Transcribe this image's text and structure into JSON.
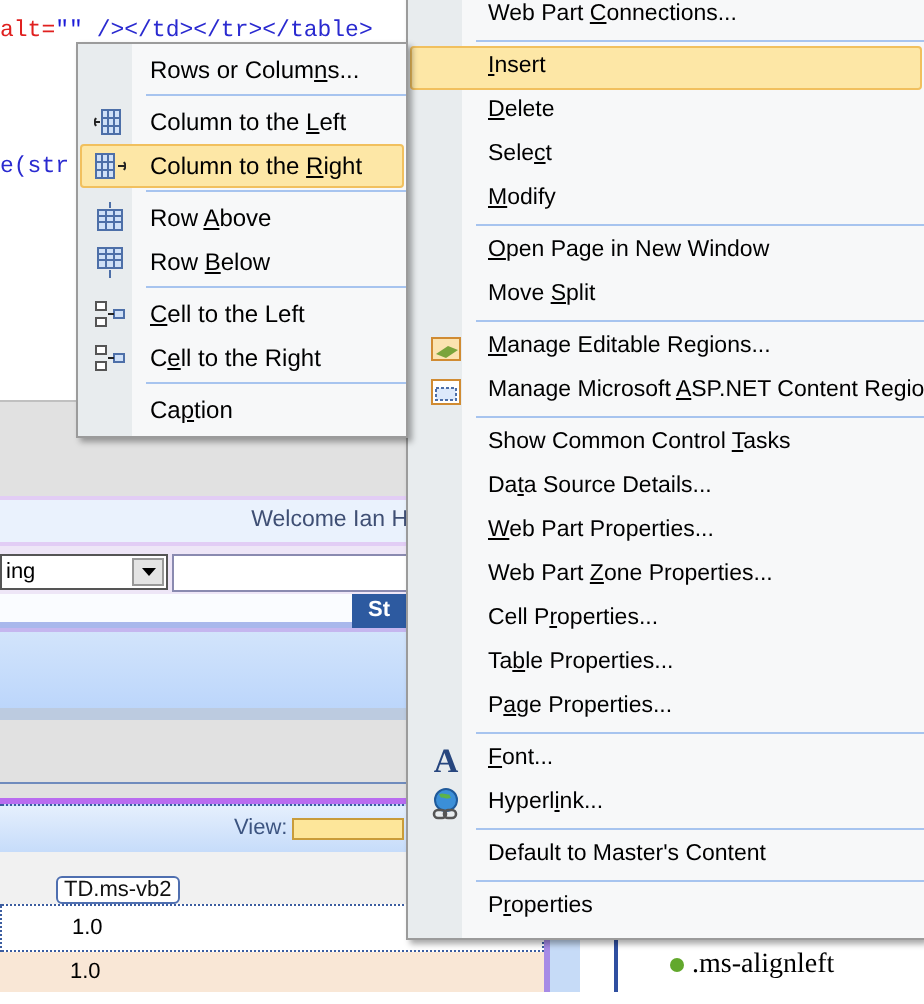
{
  "code_editor": {
    "lines": [
      {
        "parts": [
          {
            "kind": "attribute",
            "text": "alt="
          },
          {
            "kind": "value",
            "text": "\"\""
          },
          {
            "kind": "tag",
            "text": " /></td></tr></table>"
          }
        ]
      },
      {
        "parts": [
          {
            "kind": "tag",
            "text": "e(str"
          }
        ]
      }
    ]
  },
  "design_view": {
    "welcome": "Welcome Ian H",
    "dropdown_value": "ing",
    "search_button": "St",
    "view_label": "View:",
    "cell_tag": "TD.ms-vb2",
    "cells": [
      {
        "text": "1.0",
        "kind": "plain"
      },
      {
        "text": "1.0",
        "kind": "alternate"
      }
    ],
    "style_item": ".ms-alignleft"
  },
  "context_menu": {
    "items": [
      {
        "kind": "item",
        "label": {
          "before": "Web Part ",
          "key": "C",
          "after": "onnections..."
        },
        "selected": false
      },
      {
        "kind": "separator"
      },
      {
        "kind": "item",
        "label": {
          "key": "I",
          "after": "nsert"
        },
        "selected": true
      },
      {
        "kind": "item",
        "label": {
          "key": "D",
          "after": "elete"
        },
        "selected": false
      },
      {
        "kind": "item",
        "label": {
          "before": "Sele",
          "key": "c",
          "after": "t"
        },
        "selected": false
      },
      {
        "kind": "item",
        "label": {
          "key": "M",
          "after": "odify"
        },
        "selected": false
      },
      {
        "kind": "separator"
      },
      {
        "kind": "item",
        "label": {
          "key": "O",
          "after": "pen Page in New Window"
        },
        "selected": false
      },
      {
        "kind": "item",
        "label": {
          "before": "Move ",
          "key": "S",
          "after": "plit"
        },
        "selected": false
      },
      {
        "kind": "separator"
      },
      {
        "kind": "item",
        "label": {
          "key": "M",
          "after": "anage Editable Regions..."
        },
        "selected": false
      },
      {
        "kind": "item",
        "label": {
          "before": "Manage Microsoft ",
          "key": "A",
          "after": "SP.NET Content Regio"
        },
        "selected": false
      },
      {
        "kind": "separator"
      },
      {
        "kind": "item",
        "label": {
          "before": "Show Common Control ",
          "key": "T",
          "after": "asks"
        },
        "selected": false
      },
      {
        "kind": "item",
        "label": {
          "before": "Da",
          "key": "t",
          "after": "a Source Details..."
        },
        "selected": false
      },
      {
        "kind": "item",
        "label": {
          "key": "W",
          "after": "eb Part Properties..."
        },
        "selected": false
      },
      {
        "kind": "item",
        "label": {
          "before": "Web Part ",
          "key": "Z",
          "after": "one Properties..."
        },
        "selected": false
      },
      {
        "kind": "item",
        "label": {
          "before": "Cell P",
          "key": "r",
          "after": "operties..."
        },
        "selected": false
      },
      {
        "kind": "item",
        "label": {
          "before": "Ta",
          "key": "b",
          "after": "le Properties..."
        },
        "selected": false
      },
      {
        "kind": "item",
        "label": {
          "before": "P",
          "key": "a",
          "after": "ge Properties..."
        },
        "selected": false
      },
      {
        "kind": "separator"
      },
      {
        "kind": "item",
        "label": {
          "key": "F",
          "after": "ont..."
        },
        "selected": false,
        "icon_text": "A"
      },
      {
        "kind": "item",
        "label": {
          "before": "Hyperl",
          "key": "i",
          "after": "nk..."
        },
        "selected": false
      },
      {
        "kind": "separator"
      },
      {
        "kind": "item",
        "label": {
          "before": "Default to Master's Content"
        },
        "selected": false
      },
      {
        "kind": "separator"
      },
      {
        "kind": "item",
        "label": {
          "before": "P",
          "key": "r",
          "after": "operties"
        },
        "selected": false
      }
    ]
  },
  "submenu": {
    "items": [
      {
        "kind": "item",
        "label": {
          "before": "Rows or Colum",
          "key": "n",
          "after": "s..."
        },
        "selected": false
      },
      {
        "kind": "separator"
      },
      {
        "kind": "item",
        "label": {
          "before": "Column to the ",
          "key": "L",
          "after": "eft"
        },
        "selected": false
      },
      {
        "kind": "item",
        "label": {
          "before": "Column to the ",
          "key": "R",
          "after": "ight"
        },
        "selected": true
      },
      {
        "kind": "separator"
      },
      {
        "kind": "item",
        "label": {
          "before": "Row ",
          "key": "A",
          "after": "bove"
        },
        "selected": false
      },
      {
        "kind": "item",
        "label": {
          "before": "Row ",
          "key": "B",
          "after": "elow"
        },
        "selected": false
      },
      {
        "kind": "separator"
      },
      {
        "kind": "item",
        "label": {
          "key": "C",
          "after": "ell to the Left"
        },
        "selected": false
      },
      {
        "kind": "item",
        "label": {
          "before": "C",
          "key": "e",
          "after": "ll to the Right"
        },
        "selected": false
      },
      {
        "kind": "separator"
      },
      {
        "kind": "item",
        "label": {
          "before": "Ca",
          "key": "p",
          "after": "tion"
        },
        "selected": false
      }
    ]
  }
}
